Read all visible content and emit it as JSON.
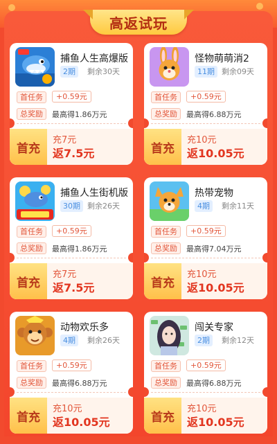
{
  "title": "高返试玩",
  "labels": {
    "first_task": "首任务",
    "total_reward": "总奖励",
    "first_charge": "首充"
  },
  "games": [
    {
      "name": "捕鱼人生高爆版",
      "period": "2期",
      "remaining": "剩余30天",
      "first_reward": "+0.59元",
      "max": "最高得1.86万元",
      "charge": "充7元",
      "back": "返7.5元",
      "icon": "shark-game-icon"
    },
    {
      "name": "怪物萌萌消2",
      "period": "11期",
      "remaining": "剩余09天",
      "first_reward": "+0.59元",
      "max": "最高得6.88万元",
      "charge": "充10元",
      "back": "返10.05元",
      "icon": "bunny-game-icon"
    },
    {
      "name": "捕鱼人生街机版",
      "period": "30期",
      "remaining": "剩余26天",
      "first_reward": "+0.59元",
      "max": "最高得1.86万元",
      "charge": "充7元",
      "back": "返7.5元",
      "icon": "arcade-fish-game-icon"
    },
    {
      "name": "热带宠物",
      "period": "4期",
      "remaining": "剩余11天",
      "first_reward": "+0.59元",
      "max": "最高得7.04万元",
      "charge": "充10元",
      "back": "返10.05元",
      "icon": "fox-game-icon"
    },
    {
      "name": "动物欢乐多",
      "period": "4期",
      "remaining": "剩余26天",
      "first_reward": "+0.59元",
      "max": "最高得6.88万元",
      "charge": "充10元",
      "back": "返10.05元",
      "icon": "monkey-game-icon"
    },
    {
      "name": "闯关专家",
      "period": "2期",
      "remaining": "剩余12天",
      "first_reward": "+0.59元",
      "max": "最高得6.88万元",
      "charge": "充10元",
      "back": "返10.05元",
      "icon": "lady-game-icon"
    }
  ]
}
